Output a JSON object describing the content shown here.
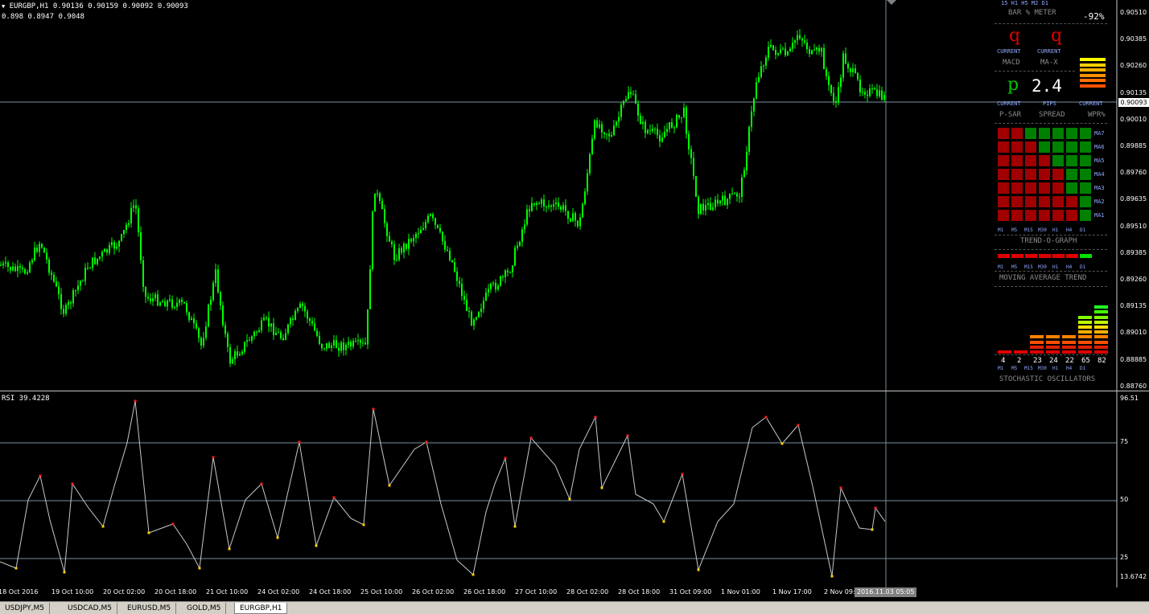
{
  "main_chart": {
    "symbol_header": "EURGBP,H1  0.90136 0.90159 0.90092 0.90093",
    "sub_header": "0.898 0.8947 0.9048",
    "current_price": "0.90093",
    "price_axis": [
      "0.90510",
      "0.90385",
      "0.90260",
      "0.90135",
      "0.90010",
      "0.89885",
      "0.89760",
      "0.89635",
      "0.89510",
      "0.89385",
      "0.89260",
      "0.89135",
      "0.89010",
      "0.88885",
      "0.88760"
    ],
    "colors": {
      "candle": "#00ff00",
      "background": "#000000",
      "grid_line": "#7890a0"
    }
  },
  "dashboard": {
    "meter_header": "BAR % METER",
    "tf_header_row": "15 H1 H5 M2 D1",
    "percent": "-92%",
    "macd": {
      "symbol": "q",
      "current": "CURRENT",
      "label": "MACD"
    },
    "max": {
      "symbol": "q",
      "current": "CURRENT",
      "label": "MA-X"
    },
    "psar": {
      "symbol": "p",
      "current": "CURRENT",
      "label": "P-SAR"
    },
    "spread": {
      "value": "2.4",
      "unit": "PIPS",
      "label": "SPREAD"
    },
    "wpr": {
      "current": "CURRENT",
      "label": "WPR%"
    },
    "trend_graph_title": "TREND-O-GRAPH",
    "ma_rows": [
      "MA7",
      "MA6",
      "MA5",
      "MA4",
      "MA3",
      "MA2",
      "MA1"
    ],
    "timeframes": [
      "M1",
      "M5",
      "M15",
      "M30",
      "H1",
      "H4",
      "D1"
    ],
    "ma_trend_title": "MOVING AVERAGE TREND",
    "stoch_values": [
      "4",
      "2",
      "23",
      "24",
      "22",
      "65",
      "82"
    ],
    "stoch_title": "STOCHASTIC OSCILLATORS",
    "trend_grid": [
      [
        0,
        0,
        1,
        1,
        1,
        1,
        1
      ],
      [
        0,
        0,
        0,
        1,
        1,
        1,
        1
      ],
      [
        0,
        0,
        0,
        0,
        1,
        1,
        1
      ],
      [
        0,
        0,
        0,
        0,
        0,
        1,
        1
      ],
      [
        0,
        0,
        0,
        0,
        0,
        1,
        1
      ],
      [
        0,
        0,
        0,
        0,
        0,
        0,
        1
      ],
      [
        0,
        0,
        0,
        0,
        0,
        0,
        1
      ]
    ],
    "ma_trend": [
      0,
      0,
      0,
      0,
      0,
      0,
      1
    ],
    "stoch_levels": [
      1,
      1,
      4,
      4,
      4,
      8,
      10
    ]
  },
  "rsi": {
    "header": "RSI 39.4228",
    "axis": [
      "96.51",
      "75",
      "50",
      "25",
      "13.6742"
    ]
  },
  "time_axis": [
    "18 Oct 2016",
    "19 Oct 10:00",
    "20 Oct 02:00",
    "20 Oct 18:00",
    "21 Oct 10:00",
    "24 Oct 02:00",
    "24 Oct 18:00",
    "25 Oct 10:00",
    "26 Oct 02:00",
    "26 Oct 18:00",
    "27 Oct 10:00",
    "28 Oct 02:00",
    "28 Oct 18:00",
    "31 Oct 09:00",
    "1 Nov 01:00",
    "1 Nov 17:00",
    "2 Nov 09:00"
  ],
  "crosshair_date": "2016.11.03 05:05",
  "tabs": [
    "USDJPY,M5",
    "USDCAD,M5",
    "EURUSD,M5",
    "GOLD,M5",
    "EURGBP,H1"
  ]
}
